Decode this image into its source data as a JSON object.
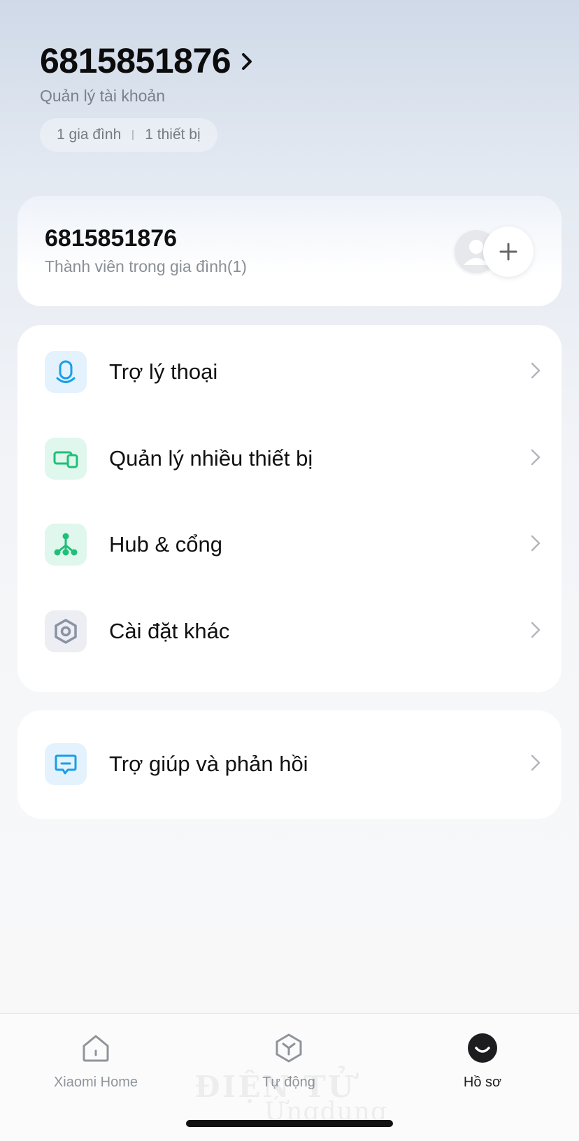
{
  "header": {
    "account_id": "6815851876",
    "account_subtitle": "Quản lý tài khoản",
    "homes_count": "1 gia đình",
    "devices_count": "1 thiết bị"
  },
  "family": {
    "name": "6815851876",
    "members_label": "Thành viên trong gia đình(1)"
  },
  "menu": {
    "items": [
      {
        "label": "Trợ lý thoại",
        "icon": "voice-assistant-icon",
        "color": "#1a9ee8",
        "bg": "#e3f2fd"
      },
      {
        "label": "Quản lý nhiều thiết bị",
        "icon": "multi-device-icon",
        "color": "#1fbf78",
        "bg": "#dff7ec"
      },
      {
        "label": "Hub & cổng",
        "icon": "hub-icon",
        "color": "#1fbf78",
        "bg": "#dff7ec"
      },
      {
        "label": "Cài đặt khác",
        "icon": "settings-hex-icon",
        "color": "#8a92a3",
        "bg": "#eceef3"
      }
    ]
  },
  "help": {
    "label": "Trợ giúp và phản hồi",
    "icon": "feedback-icon",
    "color": "#1a9ee8",
    "bg": "#e3f2fd"
  },
  "tabs": [
    {
      "label": "Xiaomi Home",
      "icon": "home-icon",
      "active": false
    },
    {
      "label": "Tự động",
      "icon": "automation-icon",
      "active": false
    },
    {
      "label": "Hồ sơ",
      "icon": "profile-icon",
      "active": true
    }
  ],
  "watermark": {
    "line1": "ĐIỆN TỬ",
    "line2": "Ứngdụng"
  }
}
